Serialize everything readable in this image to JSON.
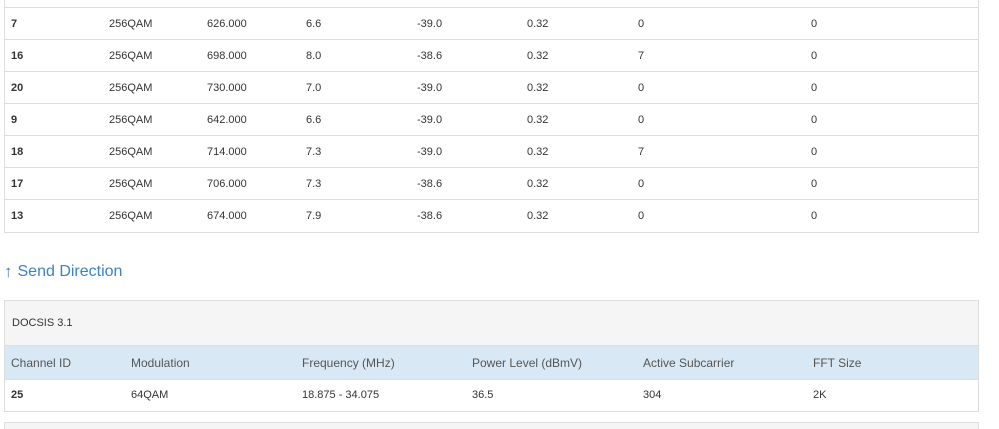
{
  "receive_table": {
    "rows": [
      [
        "7",
        "256QAM",
        "626.000",
        "6.6",
        "-39.0",
        "0.32",
        "0",
        "0"
      ],
      [
        "16",
        "256QAM",
        "698.000",
        "8.0",
        "-38.6",
        "0.32",
        "7",
        "0"
      ],
      [
        "20",
        "256QAM",
        "730.000",
        "7.0",
        "-39.0",
        "0.32",
        "0",
        "0"
      ],
      [
        "9",
        "256QAM",
        "642.000",
        "6.6",
        "-39.0",
        "0.32",
        "0",
        "0"
      ],
      [
        "18",
        "256QAM",
        "714.000",
        "7.3",
        "-39.0",
        "0.32",
        "7",
        "0"
      ],
      [
        "17",
        "256QAM",
        "706.000",
        "7.3",
        "-38.6",
        "0.32",
        "0",
        "0"
      ],
      [
        "13",
        "256QAM",
        "674.000",
        "7.9",
        "-38.6",
        "0.32",
        "0",
        "0"
      ]
    ]
  },
  "send_section": {
    "arrow_icon": "arrow-up-icon",
    "title": "Send Direction",
    "accent_color": "#3a82c9",
    "panel_title": "DOCSIS 3.1",
    "columns": [
      "Channel ID",
      "Modulation",
      "Frequency (MHz)",
      "Power Level (dBmV)",
      "Active Subcarrier",
      "FFT Size"
    ],
    "rows": [
      [
        "25",
        "64QAM",
        "18.875 - 34.075",
        "36.5",
        "304",
        "2K"
      ]
    ]
  }
}
